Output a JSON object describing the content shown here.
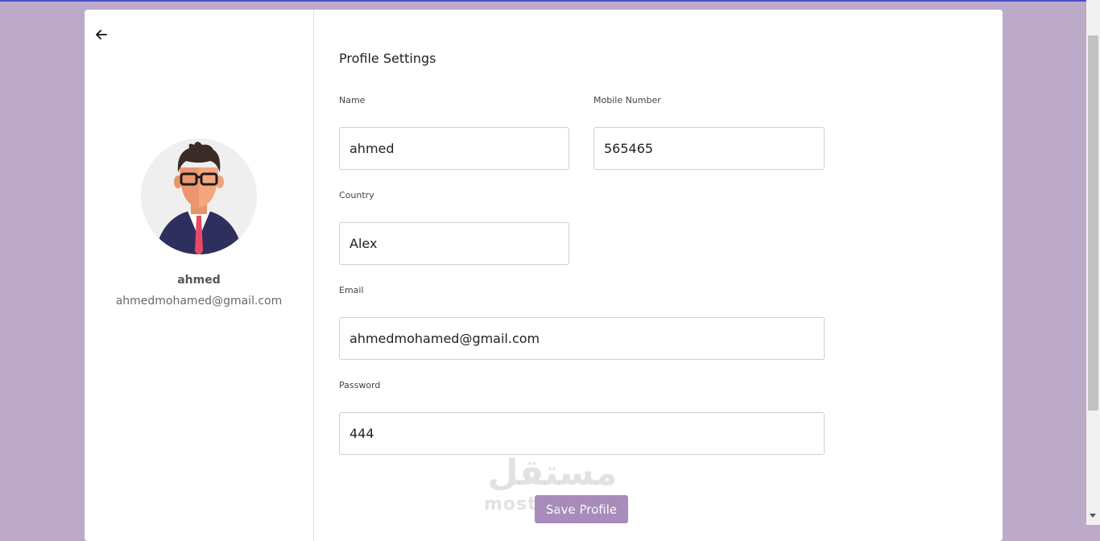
{
  "profile": {
    "name": "ahmed",
    "email": "ahmedmohamed@gmail.com"
  },
  "form": {
    "title": "Profile Settings",
    "fields": {
      "name": {
        "label": "Name",
        "value": "ahmed"
      },
      "mobile": {
        "label": "Mobile Number",
        "value": "565465"
      },
      "country": {
        "label": "Country",
        "value": "Alex"
      },
      "email": {
        "label": "Email",
        "value": "ahmedmohamed@gmail.com"
      },
      "password": {
        "label": "Password",
        "value": "444"
      }
    },
    "save_label": "Save Profile"
  },
  "watermark": {
    "arabic": "مستقل",
    "latin": "mostaql.com"
  },
  "icons": {
    "back": "arrow-left-icon",
    "avatar": "user-avatar-illustration"
  },
  "colors": {
    "background": "#bdaac8",
    "accent": "#a98bbd"
  }
}
